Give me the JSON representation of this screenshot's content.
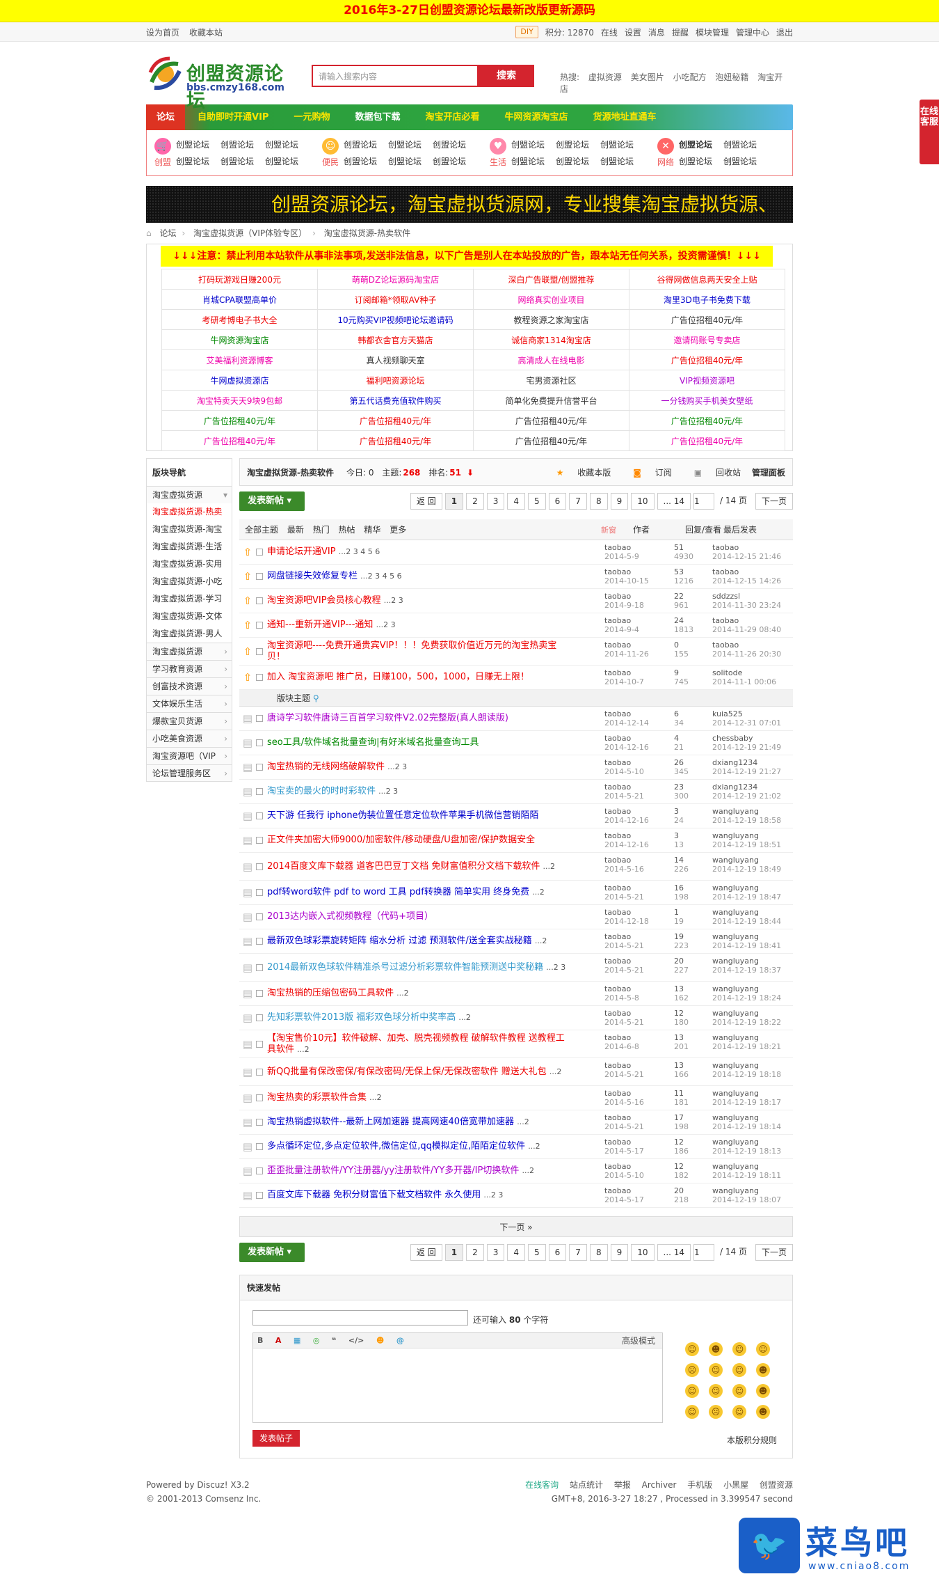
{
  "topbar": {
    "text": "2016年3-27日创盟资源论坛最新改版更新源码"
  },
  "userbar": {
    "left": [
      "设为首页",
      "收藏本站"
    ],
    "diy": "DIY",
    "points": "积分: 12870",
    "right": [
      "在线",
      "设置",
      "消息",
      "提醒",
      "模块管理",
      "管理中心",
      "退出"
    ]
  },
  "logo": {
    "name": "创盟资源论坛",
    "domain": "bbs.cmzy168.com"
  },
  "search": {
    "placeholder": "请输入搜索内容",
    "button": "搜索"
  },
  "hot": {
    "label": "热搜:",
    "items": [
      "虚拟资源",
      "美女图片",
      "小吃配方",
      "泡妞秘籍",
      "淘宝开店"
    ]
  },
  "nav": [
    "论坛",
    "自助即时开通VIP",
    "一元购物",
    "数据包下载",
    "淘宝开店必看",
    "牛网资源淘宝店",
    "货源地址直通车"
  ],
  "quick": [
    {
      "icon": "创盟",
      "links": [
        "创盟论坛",
        "创盟论坛",
        "创盟论坛",
        "创盟论坛",
        "创盟论坛",
        "创盟论坛"
      ]
    },
    {
      "icon": "便民",
      "links": [
        "创盟论坛",
        "创盟论坛",
        "创盟论坛",
        "创盟论坛",
        "创盟论坛",
        "创盟论坛"
      ]
    },
    {
      "icon": "生活",
      "links": [
        "创盟论坛",
        "创盟论坛",
        "创盟论坛",
        "创盟论坛",
        "创盟论坛",
        "创盟论坛"
      ]
    },
    {
      "icon": "网络",
      "links": [
        "创盟论坛",
        "创盟论坛",
        "创盟论坛",
        "创盟论坛"
      ]
    }
  ],
  "marquee": "创盟资源论坛，淘宝虚拟货源网，专业搜集淘宝虚拟货源、",
  "crumb": [
    "论坛",
    "淘宝虚拟货源（VIP体验专区）",
    "淘宝虚拟货源-热卖软件"
  ],
  "adwarn": "↓↓↓注意：禁止利用本站软件从事非法事项,发送非法信息，以下广告是别人在本站投放的广告，跟本站无任何关系，投资需谨慎！↓↓↓",
  "ads": [
    {
      "t": "打码玩游戏日赚200元",
      "c": "#e00"
    },
    {
      "t": "萌萌DZ论坛源码淘宝店",
      "c": "#e0a"
    },
    {
      "t": "深白广告联盟/创盟推荐",
      "c": "#e00"
    },
    {
      "t": "谷得网做信息两天安全上贴",
      "c": "#e00"
    },
    {
      "t": "肖城CPA联盟高单价",
      "c": "#00c"
    },
    {
      "t": "订阅邮箱*领取AV种子",
      "c": "#e00"
    },
    {
      "t": "网络真实创业项目",
      "c": "#e0a"
    },
    {
      "t": "淘里3D电子书免费下载",
      "c": "#00c"
    },
    {
      "t": "考研考博电子书大全",
      "c": "#e00"
    },
    {
      "t": "10元购买VIP视频吧论坛邀请码",
      "c": "#00c"
    },
    {
      "t": "教程资源之家淘宝店",
      "c": "#333"
    },
    {
      "t": "广告位招租40元/年",
      "c": "#333"
    },
    {
      "t": "牛网资源淘宝店",
      "c": "#080"
    },
    {
      "t": "韩都衣舍官方天猫店",
      "c": "#e00"
    },
    {
      "t": "诚信商家1314淘宝店",
      "c": "#e00"
    },
    {
      "t": "邀请码账号专卖店",
      "c": "#e0a"
    },
    {
      "t": "艾美福利资源博客",
      "c": "#e0a"
    },
    {
      "t": "真人视频聊天室",
      "c": "#333"
    },
    {
      "t": "高清成人在线电影",
      "c": "#e0a"
    },
    {
      "t": "广告位招租40元/年",
      "c": "#e00"
    },
    {
      "t": "牛网虚拟资源店",
      "c": "#00c"
    },
    {
      "t": "福利吧资源论坛",
      "c": "#e00"
    },
    {
      "t": "宅男资源社区",
      "c": "#333"
    },
    {
      "t": "VIP视频资源吧",
      "c": "#a0c"
    },
    {
      "t": "淘宝特卖天天9块9包邮",
      "c": "#e0a"
    },
    {
      "t": "第五代话费充值软件购买",
      "c": "#00c"
    },
    {
      "t": "简单化免费提升信誉平台",
      "c": "#333"
    },
    {
      "t": "一分钱购买手机美女壁纸",
      "c": "#a0c"
    },
    {
      "t": "广告位招租40元/年",
      "c": "#080"
    },
    {
      "t": "广告位招租40元/年",
      "c": "#e00"
    },
    {
      "t": "广告位招租40元/年",
      "c": "#333"
    },
    {
      "t": "广告位招租40元/年",
      "c": "#080"
    },
    {
      "t": "广告位招租40元/年",
      "c": "#e0a"
    },
    {
      "t": "广告位招租40元/年",
      "c": "#e00"
    },
    {
      "t": "广告位招租40元/年",
      "c": "#333"
    },
    {
      "t": "广告位招租40元/年",
      "c": "#e0a"
    }
  ],
  "sidebar": {
    "title": "版块导航",
    "groups": [
      {
        "label": "淘宝虚拟货源",
        "subs": [
          "淘宝虚拟货源-热卖",
          "淘宝虚拟货源-淘宝",
          "淘宝虚拟货源-生活",
          "淘宝虚拟货源-实用",
          "淘宝虚拟货源-小吃",
          "淘宝虚拟货源-学习",
          "淘宝虚拟货源-文体",
          "淘宝虚拟货源-男人"
        ]
      },
      {
        "label": "淘宝虚拟货源"
      },
      {
        "label": "学习教育资源"
      },
      {
        "label": "创富技术资源"
      },
      {
        "label": "文体娱乐生活"
      },
      {
        "label": "爆款宝贝货源"
      },
      {
        "label": "小吃美食资源"
      },
      {
        "label": "淘宝资源吧（VIP"
      },
      {
        "label": "论坛管理服务区"
      }
    ]
  },
  "forum": {
    "name": "淘宝虚拟货源-热卖软件",
    "today": "今日: 0",
    "threads_label": "主题:",
    "threads": "268",
    "rank_label": "排名:",
    "rank": "51",
    "actions": [
      "收藏本版",
      "订阅",
      "回收站",
      "管理面板"
    ]
  },
  "pager": {
    "post": "发表新帖",
    "back": "返 回",
    "pages": [
      "1",
      "2",
      "3",
      "4",
      "5",
      "6",
      "7",
      "8",
      "9",
      "10",
      "... 14"
    ],
    "input": "1",
    "total": "/ 14 页",
    "next": "下一页"
  },
  "filter": {
    "items": [
      "全部主题",
      "最新",
      "热门",
      "热帖",
      "精华",
      "更多"
    ],
    "newwin": "新窗",
    "col_author": "作者",
    "col_reply": "回复/查看",
    "col_last": "最后发表"
  },
  "sticky": [
    {
      "t": "申请论坛开通VIP",
      "c": "#e00",
      "pg": "...2 3 4 5 6",
      "au": "taobao",
      "d": "2014-5-9",
      "r": "51",
      "v": "4930",
      "la": "taobao",
      "ld": "2014-12-15 21:46"
    },
    {
      "t": "网盘链接失效修复专栏",
      "c": "#00c",
      "pg": "...2 3 4 5 6",
      "au": "taobao",
      "d": "2014-10-15",
      "r": "53",
      "v": "1216",
      "la": "taobao",
      "ld": "2014-12-15 14:26"
    },
    {
      "t": "淘宝资源吧VIP会员核心教程",
      "c": "#e00",
      "pg": "...2 3",
      "au": "taobao",
      "d": "2014-9-18",
      "r": "22",
      "v": "961",
      "la": "sddzzsl",
      "ld": "2014-11-30 23:24"
    },
    {
      "t": "通知---重新开通VIP---通知",
      "c": "#e00",
      "pg": "...2 3",
      "au": "taobao",
      "d": "2014-9-4",
      "r": "24",
      "v": "1813",
      "la": "taobao",
      "ld": "2014-11-29 08:40"
    },
    {
      "t": "淘宝资源吧----免费开通贵宾VIP！！！免费获取价值近万元的淘宝热卖宝贝！",
      "c": "#e00",
      "pg": "",
      "au": "taobao",
      "d": "2014-11-26",
      "r": "0",
      "v": "155",
      "la": "taobao",
      "ld": "2014-11-26 20:30",
      "tall": true
    },
    {
      "t": "加入 淘宝资源吧 推广员，日赚100，500，1000，日赚无上限！",
      "c": "#e00",
      "pg": "",
      "au": "taobao",
      "d": "2014-10-7",
      "r": "9",
      "v": "745",
      "la": "solitode",
      "ld": "2014-11-1 00:06"
    }
  ],
  "sep": "版块主题",
  "threads": [
    {
      "t": "唐诗学习软件唐诗三百首学习软件V2.02完整版(真人朗读版)",
      "c": "#a0c",
      "pg": "",
      "au": "taobao",
      "d": "2014-12-14",
      "r": "6",
      "v": "34",
      "la": "kuia525",
      "ld": "2014-12-31 07:01"
    },
    {
      "t": "seo工具/软件域名批量查询|有好米域名批量查询工具",
      "c": "#080",
      "pg": "",
      "au": "taobao",
      "d": "2014-12-16",
      "r": "4",
      "v": "21",
      "la": "chessbaby",
      "ld": "2014-12-19 21:49"
    },
    {
      "t": "淘宝热销的无线网络破解软件",
      "c": "#e00",
      "pg": "...2 3",
      "au": "taobao",
      "d": "2014-5-10",
      "r": "26",
      "v": "345",
      "la": "dxiang1234",
      "ld": "2014-12-19 21:27"
    },
    {
      "t": "淘宝卖的最火的时时彩软件",
      "c": "#39c",
      "pg": "...2 3",
      "au": "taobao",
      "d": "2014-5-21",
      "r": "23",
      "v": "300",
      "la": "dxiang1234",
      "ld": "2014-12-19 21:02"
    },
    {
      "t": "天下游 任我行 iphone伪装位置任意定位软件苹果手机微信营销陌陌",
      "c": "#00c",
      "pg": "",
      "au": "taobao",
      "d": "2014-12-16",
      "r": "3",
      "v": "24",
      "la": "wangluyang",
      "ld": "2014-12-19 18:58"
    },
    {
      "t": "正文件夹加密大师9000/加密软件/移动硬盘/U盘加密/保护数据安全",
      "c": "#e00",
      "pg": "",
      "au": "taobao",
      "d": "2014-12-16",
      "r": "3",
      "v": "13",
      "la": "wangluyang",
      "ld": "2014-12-19 18:51"
    },
    {
      "t": "2014百度文库下载器 道客巴巴豆丁文档 免财富值积分文档下载软件",
      "c": "#e00",
      "pg": "...2",
      "au": "taobao",
      "d": "2014-5-16",
      "r": "14",
      "v": "226",
      "la": "wangluyang",
      "ld": "2014-12-19 18:49",
      "tall": true
    },
    {
      "t": "pdf转word软件 pdf to word 工具 pdf转换器 简单实用 终身免费",
      "c": "#00c",
      "pg": "...2",
      "au": "taobao",
      "d": "2014-5-21",
      "r": "16",
      "v": "198",
      "la": "wangluyang",
      "ld": "2014-12-19 18:47"
    },
    {
      "t": "2013达内嵌入式视频教程（代码+项目）",
      "c": "#a0c",
      "pg": "",
      "au": "taobao",
      "d": "2014-12-18",
      "r": "1",
      "v": "19",
      "la": "wangluyang",
      "ld": "2014-12-19 18:44"
    },
    {
      "t": "最新双色球彩票旋转矩阵 缩水分析 过滤 预测软件/送全套实战秘籍",
      "c": "#00c",
      "pg": "...2",
      "au": "taobao",
      "d": "2014-5-21",
      "r": "19",
      "v": "223",
      "la": "wangluyang",
      "ld": "2014-12-19 18:41"
    },
    {
      "t": "2014最新双色球软件精准杀号过滤分析彩票软件智能预测送中奖秘籍",
      "c": "#39c",
      "pg": "...2 3",
      "au": "taobao",
      "d": "2014-5-21",
      "r": "20",
      "v": "227",
      "la": "wangluyang",
      "ld": "2014-12-19 18:37",
      "tall": true
    },
    {
      "t": "淘宝热销的压缩包密码工具软件",
      "c": "#e00",
      "pg": "...2",
      "au": "taobao",
      "d": "2014-5-8",
      "r": "13",
      "v": "162",
      "la": "wangluyang",
      "ld": "2014-12-19 18:24"
    },
    {
      "t": "先知彩票软件2013版 福彩双色球分析中奖率高",
      "c": "#39c",
      "pg": "...2",
      "au": "taobao",
      "d": "2014-5-21",
      "r": "12",
      "v": "180",
      "la": "wangluyang",
      "ld": "2014-12-19 18:22"
    },
    {
      "t": "【淘宝售价10元】软件破解、加壳、脱壳视频教程 破解软件教程 送教程工具软件",
      "c": "#e00",
      "pg": "...2",
      "au": "taobao",
      "d": "2014-6-8",
      "r": "13",
      "v": "201",
      "la": "wangluyang",
      "ld": "2014-12-19 18:21",
      "tall": true
    },
    {
      "t": "新QQ批量有保改密保/有保改密码/无保上保/无保改密软件 赠送大礼包",
      "c": "#e00",
      "pg": "...2",
      "au": "taobao",
      "d": "2014-5-21",
      "r": "13",
      "v": "166",
      "la": "wangluyang",
      "ld": "2014-12-19 18:18",
      "tall": true
    },
    {
      "t": "淘宝热卖的彩票软件合集",
      "c": "#e00",
      "pg": "...2",
      "au": "taobao",
      "d": "2014-5-16",
      "r": "11",
      "v": "181",
      "la": "wangluyang",
      "ld": "2014-12-19 18:17"
    },
    {
      "t": "淘宝热销虚拟软件--最新上网加速器 提高网速40倍宽带加速器",
      "c": "#00c",
      "pg": "...2",
      "au": "taobao",
      "d": "2014-5-21",
      "r": "17",
      "v": "198",
      "la": "wangluyang",
      "ld": "2014-12-19 18:14"
    },
    {
      "t": "多点循环定位,多点定位软件,微信定位,qq模拟定位,陌陌定位软件",
      "c": "#00c",
      "pg": "...2",
      "au": "taobao",
      "d": "2014-5-17",
      "r": "12",
      "v": "186",
      "la": "wangluyang",
      "ld": "2014-12-19 18:13"
    },
    {
      "t": "歪歪批量注册软件/YY注册器/yy注册软件/YY多开器/IP切换软件",
      "c": "#a0c",
      "pg": "...2",
      "au": "taobao",
      "d": "2014-5-10",
      "r": "12",
      "v": "182",
      "la": "wangluyang",
      "ld": "2014-12-19 18:11"
    },
    {
      "t": "百度文库下载器 免积分财富值下载文档软件 永久使用",
      "c": "#00c",
      "pg": "...2 3",
      "au": "taobao",
      "d": "2014-5-17",
      "r": "20",
      "v": "218",
      "la": "wangluyang",
      "ld": "2014-12-19 18:07"
    }
  ],
  "nextpage": "下一页 »",
  "quickpost": {
    "title": "快速发帖",
    "remain_pre": "还可输入",
    "remain_num": "80",
    "remain_post": "个字符",
    "advanced": "高级模式",
    "toolbar": [
      "B",
      "A",
      "▦",
      "◎",
      "❝",
      "</>",
      "☻",
      "@"
    ],
    "submit": "发表帖子",
    "rules": "本版积分规则",
    "smilies": [
      "☺",
      "☻",
      "☺",
      "☺",
      "☹",
      "☺",
      "☺",
      "☻",
      "☺",
      "☺",
      "☺",
      "☻",
      "☺",
      "☹",
      "☺",
      "☻"
    ]
  },
  "footer": {
    "powered": "Powered by Discuz! X3.2",
    "copy": "© 2001-2013 Comsenz Inc.",
    "links": [
      "在线客询",
      "站点统计",
      "举报",
      "Archiver",
      "手机版",
      "小黑屋",
      "创盟资源"
    ],
    "time": "GMT+8, 2016-3-27 18:27 , Processed in 3.399547 second"
  },
  "sidebtn": "在线客服",
  "watermark": {
    "name": "菜鸟吧",
    "url": "www.cniao8.com"
  }
}
